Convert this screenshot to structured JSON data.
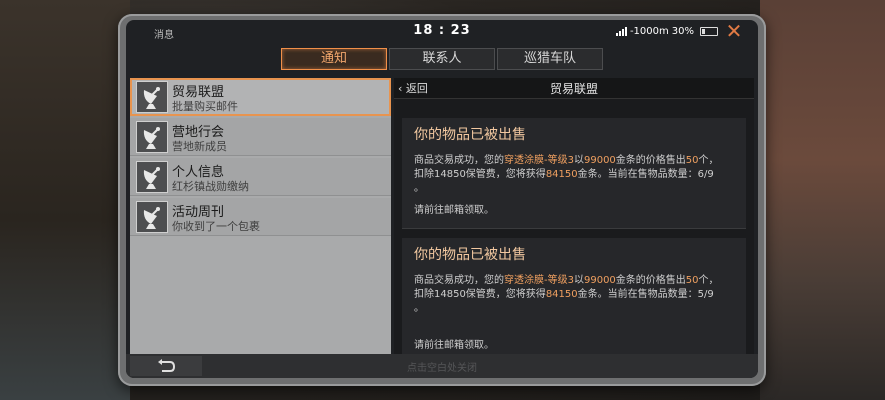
{
  "status": {
    "left_label": "消息",
    "time": "18 : 23",
    "network": "-1000m",
    "battery": "30%"
  },
  "tabs": [
    {
      "label": "通知",
      "active": true
    },
    {
      "label": "联系人",
      "active": false
    },
    {
      "label": "巡猎车队",
      "active": false
    }
  ],
  "mail_list": [
    {
      "title": "贸易联盟",
      "subtitle": "批量购买邮件",
      "icon": "satellite-dish-icon",
      "selected": true
    },
    {
      "title": "营地行会",
      "subtitle": "营地新成员",
      "icon": "satellite-dish-icon",
      "selected": false
    },
    {
      "title": "个人信息",
      "subtitle": "红杉镇战勋缴纳",
      "icon": "satellite-dish-icon",
      "selected": false
    },
    {
      "title": "活动周刊",
      "subtitle": "你收到了一个包裹",
      "icon": "satellite-dish-icon",
      "selected": false
    }
  ],
  "detail": {
    "back_label": "返回",
    "title": "贸易联盟",
    "messages": [
      {
        "title": "你的物品已被出售",
        "p1": "商品交易成功，您的",
        "item": "穿透涂膜-等级3",
        "p2": "以",
        "price": "99000",
        "p3": "金条的价格售出",
        "qty": "50",
        "p4": "个，",
        "p5": "扣除14850保管费，您将获得",
        "gain": "84150",
        "p6": "金条。当前在售物品数量：6/9",
        "p7": "。",
        "note": "请前往邮箱领取。"
      },
      {
        "title": "你的物品已被出售",
        "p1": "商品交易成功，您的",
        "item": "穿透涂膜-等级3",
        "p2": "以",
        "price": "99000",
        "p3": "金条的价格售出",
        "qty": "50",
        "p4": "个，",
        "p5": "扣除14850保管费，您将获得",
        "gain": "84150",
        "p6": "金条。当前在售物品数量：5/9",
        "p7": "。",
        "note": "请前往邮箱领取。"
      }
    ]
  },
  "footer": {
    "hint": "点击空白处关闭",
    "back_icon": "return-arrow-icon"
  },
  "colors": {
    "accent": "#f19049",
    "highlight": "#f0a060"
  }
}
